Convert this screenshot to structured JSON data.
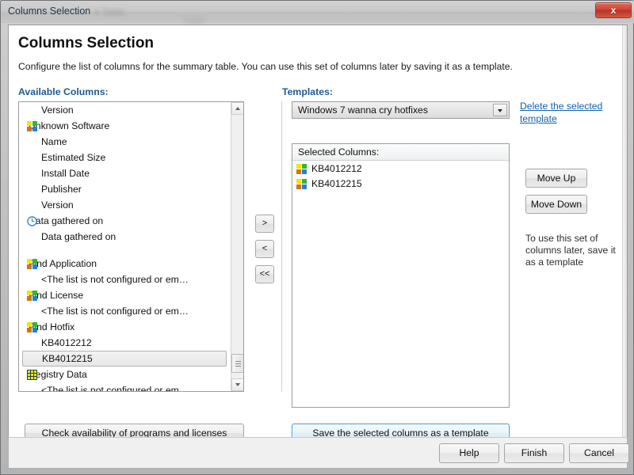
{
  "window": {
    "title": "Columns Selection",
    "ghost_text_1": "n  Table",
    "ghost_text_2": "Table",
    "close_label": "x"
  },
  "page": {
    "title": "Columns Selection",
    "subtitle": "Configure the list of columns for the summary table. You can use this set of columns later by saving it as a template."
  },
  "available": {
    "label": "Available Columns:",
    "items": [
      {
        "text": "Version",
        "icon": "none",
        "indent": true
      },
      {
        "text": "Unknown Software",
        "icon": "win-tile",
        "indent": false
      },
      {
        "text": "Name",
        "icon": "none",
        "indent": true
      },
      {
        "text": "Estimated Size",
        "icon": "none",
        "indent": true
      },
      {
        "text": "Install Date",
        "icon": "none",
        "indent": true
      },
      {
        "text": "Publisher",
        "icon": "none",
        "indent": true
      },
      {
        "text": "Version",
        "icon": "none",
        "indent": true
      },
      {
        "text": "Data gathered on",
        "icon": "clock",
        "indent": false
      },
      {
        "text": "Data gathered on",
        "icon": "none",
        "indent": true
      },
      {
        "text": "",
        "icon": "none",
        "indent": true,
        "spacer": true
      },
      {
        "text": "Find Application",
        "icon": "win-tile",
        "indent": false
      },
      {
        "text": "<The list is not configured or em…",
        "icon": "none",
        "indent": true
      },
      {
        "text": "Find License",
        "icon": "win-tile",
        "indent": false
      },
      {
        "text": "<The list is not configured or em…",
        "icon": "none",
        "indent": true
      },
      {
        "text": "Find Hotfix",
        "icon": "win-tile",
        "indent": false
      },
      {
        "text": "KB4012212",
        "icon": "none",
        "indent": true
      },
      {
        "text": "KB4012215",
        "icon": "none",
        "indent": true,
        "selected": true
      },
      {
        "text": "Registry Data",
        "icon": "grid",
        "indent": false
      },
      {
        "text": "<The list is not configured or em…",
        "icon": "none",
        "indent": true
      }
    ]
  },
  "transfer": {
    "add_label": ">",
    "remove_label": "<",
    "remove_all_label": "<<"
  },
  "templates": {
    "label": "Templates:",
    "selected": "Windows 7 wanna cry hotfixes",
    "delete_link": "Delete the selected template"
  },
  "selected_columns": {
    "header": "Selected Columns:",
    "items": [
      {
        "text": "KB4012212",
        "icon": "win-tile"
      },
      {
        "text": "KB4012215",
        "icon": "win-tile"
      }
    ]
  },
  "side": {
    "move_up_label": "Move Up",
    "move_down_label": "Move Down",
    "hint": "To use this set of columns later, save it as a template"
  },
  "actions": {
    "check_availability_label": "Check availability of programs and licenses",
    "save_template_label": "Save the selected columns as a template"
  },
  "footer": {
    "help_label": "Help",
    "finish_label": "Finish",
    "cancel_label": "Cancel"
  },
  "colors": {
    "accent_link": "#1361b0",
    "section_label": "#1f5a8f",
    "default_button_border": "#3c9ad4",
    "close_button": "#cf4636"
  }
}
